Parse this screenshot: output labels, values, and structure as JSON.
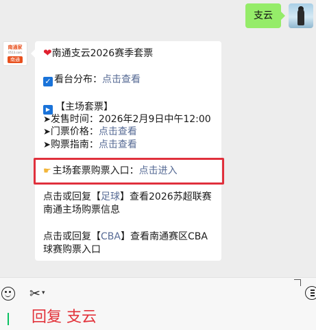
{
  "user_message": {
    "text": "支云"
  },
  "bot": {
    "avatar": {
      "logo_top": "南通家",
      "logo_mid": "0513.com",
      "logo_bottom": "南通"
    },
    "lines": {
      "title": "南通支云2026赛季套票",
      "stand_label": "看台分布：",
      "stand_link": "点击查看",
      "section_title": "【主场套票】",
      "sale_time_label": "发售时间：",
      "sale_time_value": "2026年2月9日中午12:00",
      "price_label": "门票价格：",
      "price_link": "点击查看",
      "guide_label": "购票指南：",
      "guide_link": "点击查看",
      "entry_label": "主场套票购票入口：",
      "entry_link": "点击进入",
      "football_line1_prefix": "点击或回复【",
      "football_keyword": "足球",
      "football_line1_suffix": "】查看2026苏超联赛",
      "football_line2": "南通主场购票信息",
      "cba_line1_prefix": "点击或回复【",
      "cba_keyword": "CBA",
      "cba_line1_suffix": "】查看南通赛区CBA",
      "cba_line2": "球赛购票入口"
    }
  },
  "input": {
    "reply_hint": "回复 支云"
  },
  "colors": {
    "link": "#576b95",
    "highlight": "#e0303c",
    "user_bubble": "#95ec69",
    "reply_text": "#e2323a"
  }
}
